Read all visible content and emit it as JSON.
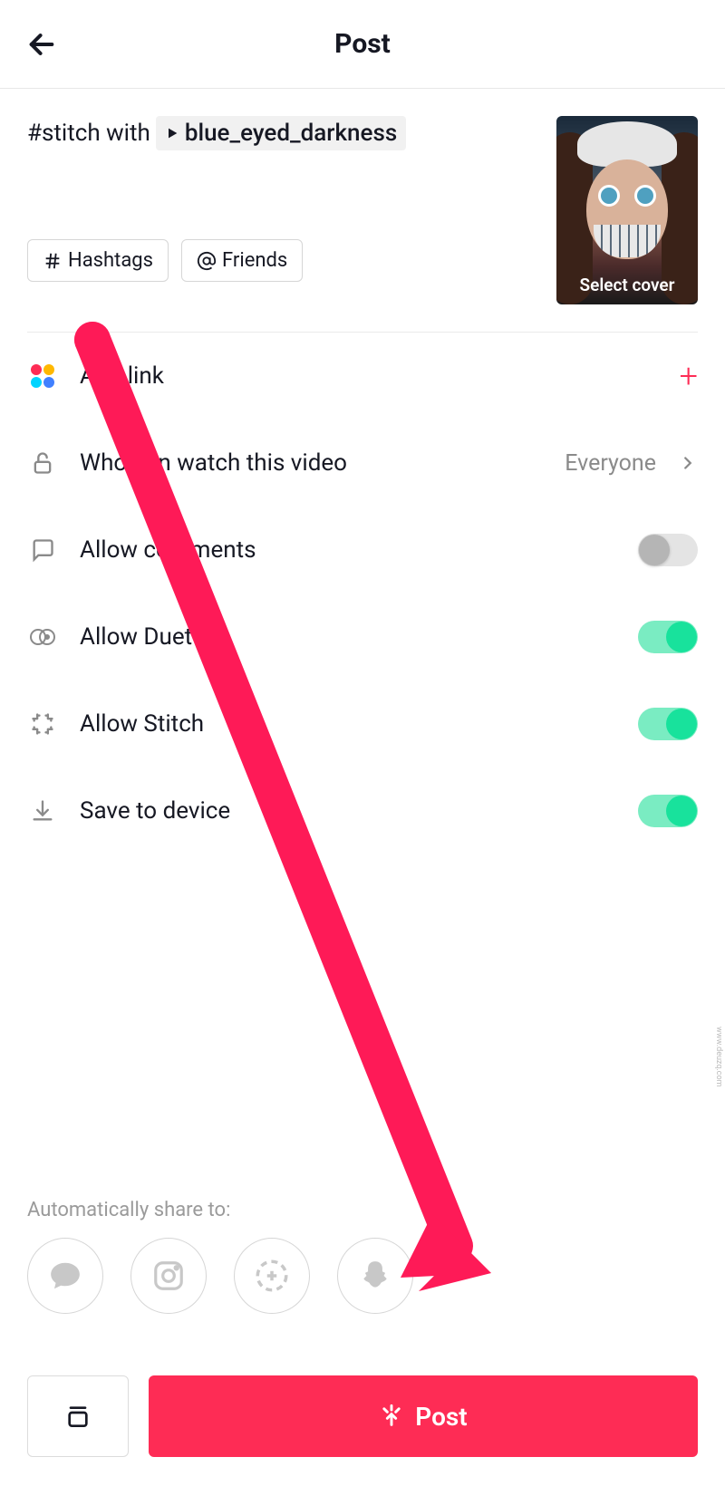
{
  "header": {
    "title": "Post"
  },
  "caption": {
    "prefix": "#stitch with",
    "mention": "blue_eyed_darkness"
  },
  "chips": {
    "hashtags": "Hashtags",
    "friends": "Friends"
  },
  "thumbnail": {
    "select_cover": "Select cover"
  },
  "options": {
    "add_link": {
      "label": "Add link"
    },
    "privacy": {
      "label": "Who can watch this video",
      "value": "Everyone"
    },
    "comments": {
      "label": "Allow comments",
      "on": false
    },
    "duet": {
      "label": "Allow Duet",
      "on": true
    },
    "stitch": {
      "label": "Allow Stitch",
      "on": true
    },
    "save": {
      "label": "Save to device",
      "on": true
    }
  },
  "share": {
    "label": "Automatically share to:",
    "targets": [
      "messages",
      "instagram",
      "stories",
      "snapchat"
    ]
  },
  "bottom": {
    "post_label": "Post"
  },
  "watermark": "www.deuzq.com"
}
